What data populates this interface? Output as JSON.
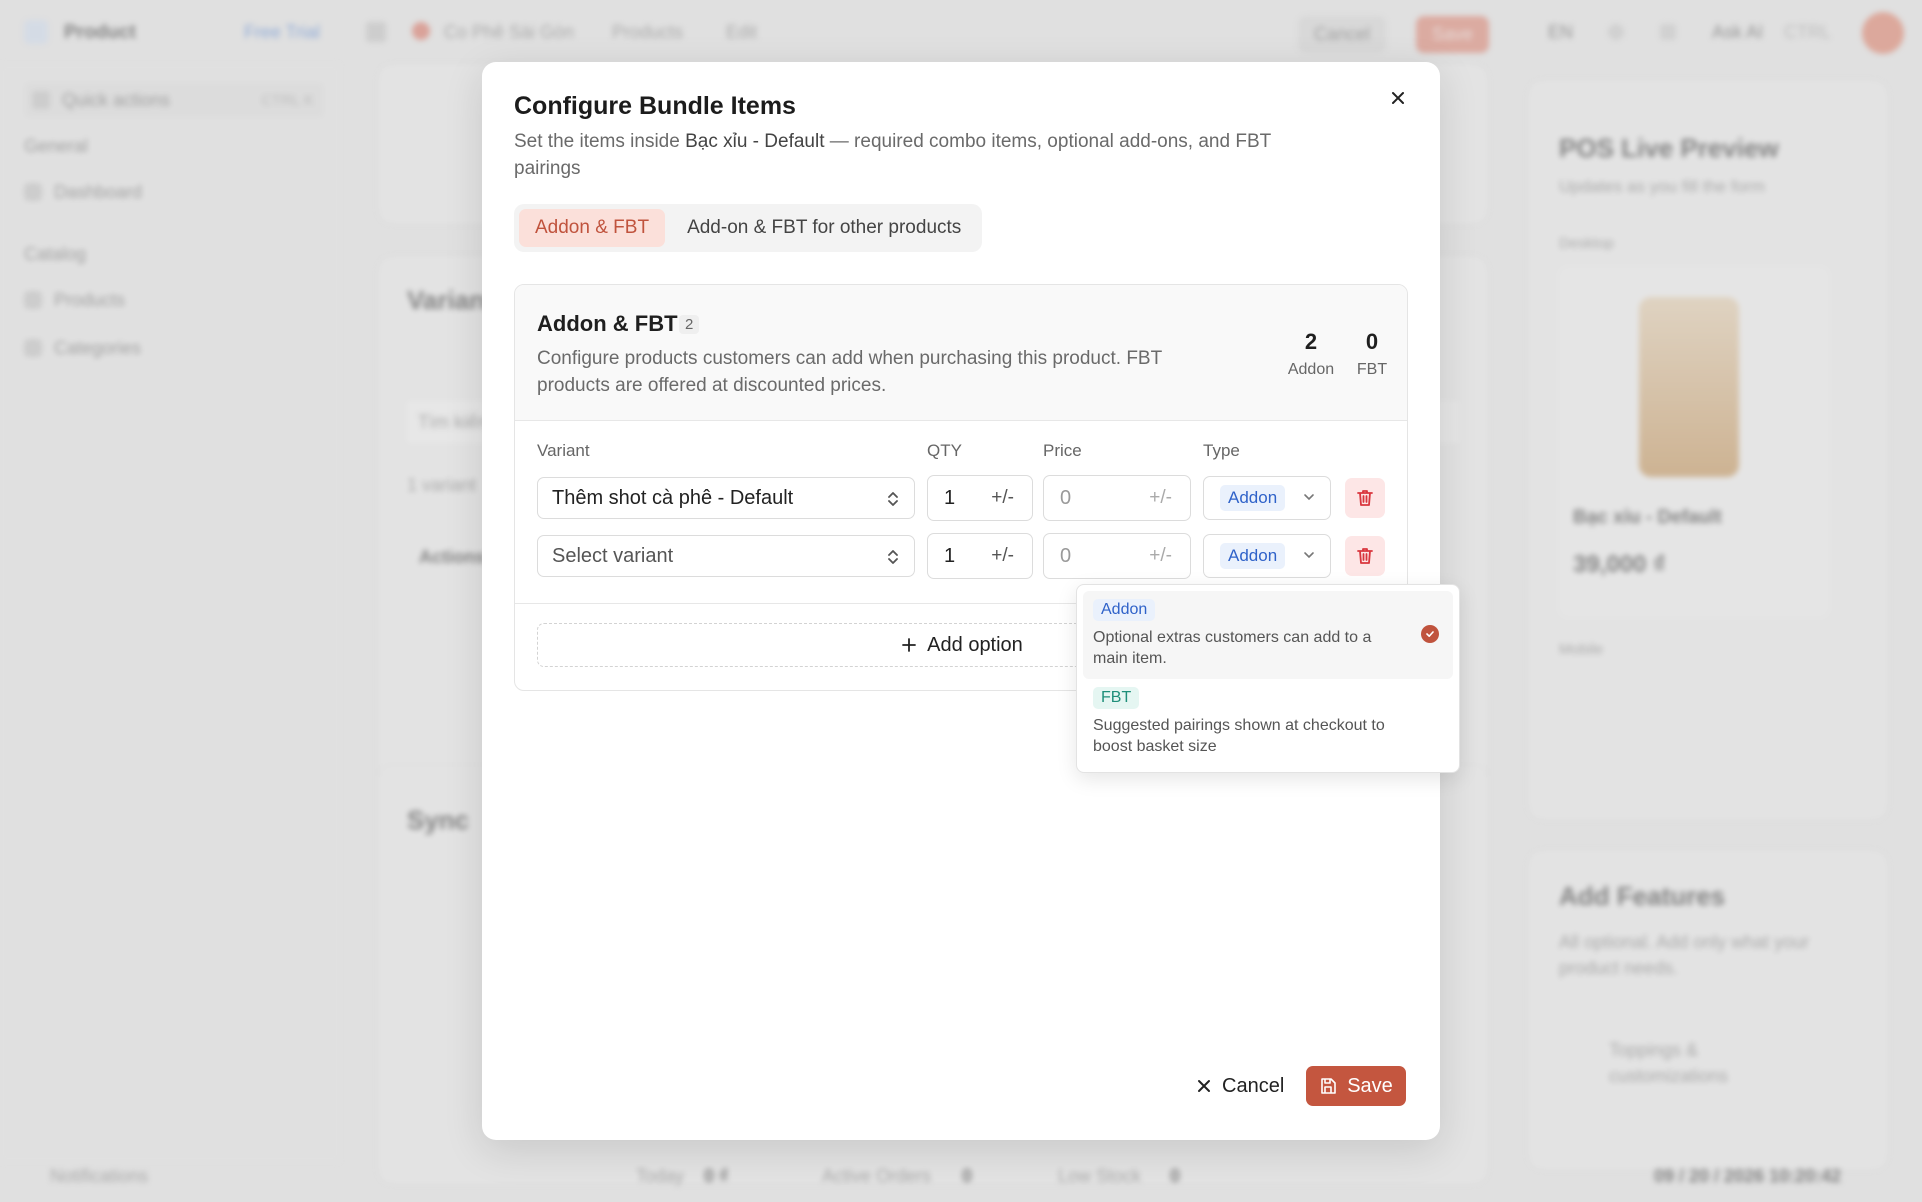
{
  "background": {
    "app_name": "Product",
    "free_trial": "Free Trial",
    "breadcrumb": [
      "Co Phê Sài Gòn",
      "Products",
      "Edit"
    ],
    "topbar_cancel": "Cancel",
    "topbar_save": "Save",
    "lang": "EN",
    "search_label": "Ask AI",
    "search_shortcut": "CTRL",
    "sidebar": {
      "quick_actions": "Quick actions",
      "quick_shortcut": "CTRL K",
      "general": "General",
      "dashboard": "Dashboard",
      "catalog": "Catalog",
      "products": "Products",
      "categories": "Categories",
      "notifications": "Notifications"
    },
    "main": {
      "variants_title": "Variants",
      "sync_title": "Sync",
      "variant_search": "Tìm kiếm",
      "variant_count": "1 variant",
      "actions": "Actions"
    },
    "preview": {
      "title": "POS Live Preview",
      "subtitle": "Updates as you fill the form",
      "desktop": "Desktop",
      "mobile": "Mobile",
      "product_name": "Bạc xỉu - Default",
      "product_price": "39,000 ₫",
      "add_features_title": "Add Features",
      "add_features_desc": "All optional. Add only what your product needs.",
      "feature_item": "Toppings & customizations"
    },
    "statusbar": {
      "today": "Today",
      "today_val": "0 ₫",
      "active_orders": "Active Orders",
      "active_val": "0",
      "low_stock": "Low Stock",
      "low_val": "0",
      "datetime": "09 / 20 / 2026 10:20:42"
    }
  },
  "modal": {
    "title": "Configure Bundle Items",
    "description_prefix": "Set the items inside ",
    "description_product": "Bạc xỉu - Default",
    "description_suffix": " — required combo items, optional add-ons, and FBT pairings",
    "tabs": [
      {
        "label": "Addon & FBT",
        "active": true
      },
      {
        "label": "Add-on & FBT for other products",
        "active": false
      }
    ],
    "section": {
      "title": "Addon & FBT",
      "count": "2",
      "description": "Configure products customers can add when purchasing this product. FBT products are offered at discounted prices.",
      "stats": [
        {
          "value": "2",
          "label": "Addon"
        },
        {
          "value": "0",
          "label": "FBT"
        }
      ],
      "columns": [
        "Variant",
        "QTY",
        "Price",
        "Type"
      ],
      "rows": [
        {
          "variant": "Thêm shot cà phê - Default",
          "qty": "1",
          "qty_suffix": "+/-",
          "price": "0",
          "price_suffix": "+/-",
          "type": "Addon"
        },
        {
          "variant": "Select variant",
          "qty": "1",
          "qty_suffix": "+/-",
          "price": "0",
          "price_suffix": "+/-",
          "type": "Addon"
        }
      ],
      "add_option": "Add option"
    },
    "dropdown": [
      {
        "badge": "Addon",
        "description": "Optional extras customers can add to a main item.",
        "selected": true
      },
      {
        "badge": "FBT",
        "description": "Suggested pairings shown at checkout to boost basket size",
        "selected": false
      }
    ],
    "cancel": "Cancel",
    "save": "Save"
  },
  "colors": {
    "accent": "#c4563f",
    "tab_active_bg": "#fbe0da",
    "addon_badge": "#2f62c9",
    "fbt_badge": "#1f8f7a",
    "danger": "#d9363e"
  }
}
